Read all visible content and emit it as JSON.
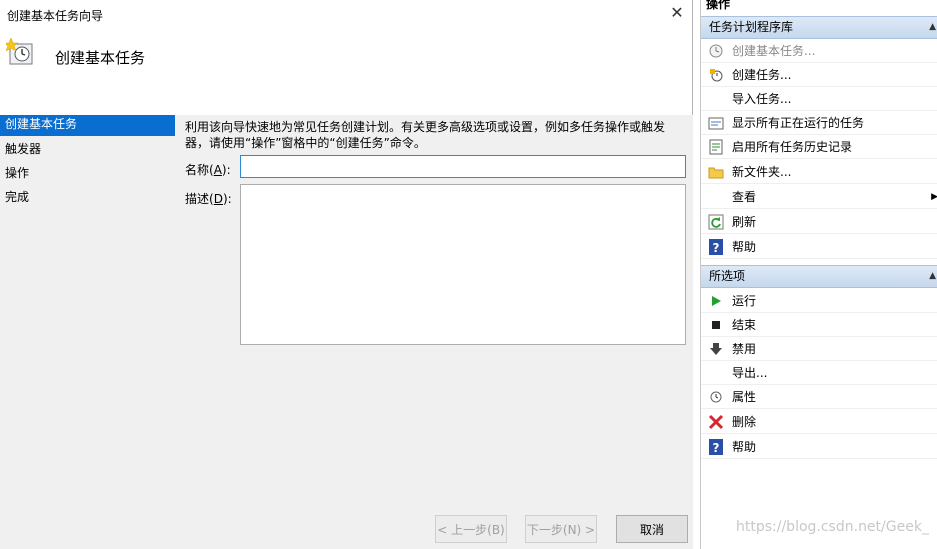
{
  "wizard": {
    "title": "创建基本任务向导",
    "header_title": "创建基本任务",
    "steps": [
      "创建基本任务",
      "触发器",
      "操作",
      "完成"
    ],
    "description": "利用该向导快速地为常见任务创建计划。有关更多高级选项或设置，例如多任务操作或触发器，请使用“操作”窗格中的“创建任务”命令。",
    "name_label": "名称",
    "name_key": "A",
    "name_value": "",
    "desc_label": "描述",
    "desc_key": "D",
    "desc_value": "",
    "prev_label": "< 上一步(B)",
    "next_label": "下一步(N) >",
    "cancel_label": "取消"
  },
  "actions": {
    "title": "操作",
    "section1": {
      "title": "任务计划程序库",
      "items": [
        {
          "label": "创建基本任务...",
          "icon": "clock-wizard-icon"
        },
        {
          "label": "创建任务...",
          "icon": "task-icon"
        },
        {
          "label": "导入任务...",
          "icon": "none"
        },
        {
          "label": "显示所有正在运行的任务",
          "icon": "running-tasks-icon"
        },
        {
          "label": "启用所有任务历史记录",
          "icon": "history-icon"
        },
        {
          "label": "新文件夹...",
          "icon": "folder-icon"
        },
        {
          "label": "查看",
          "icon": "none"
        },
        {
          "label": "刷新",
          "icon": "refresh-icon"
        },
        {
          "label": "帮助",
          "icon": "help-icon"
        }
      ]
    },
    "section2": {
      "title": "所选项",
      "items": [
        {
          "label": "运行",
          "icon": "run-icon"
        },
        {
          "label": "结束",
          "icon": "stop-icon"
        },
        {
          "label": "禁用",
          "icon": "disable-icon"
        },
        {
          "label": "导出...",
          "icon": "none"
        },
        {
          "label": "属性",
          "icon": "properties-icon"
        },
        {
          "label": "删除",
          "icon": "delete-icon"
        },
        {
          "label": "帮助",
          "icon": "help-icon"
        }
      ]
    }
  },
  "watermark": "https://blog.csdn.net/Geek_",
  "colors": {
    "selection": "#0a6ed1",
    "help_blue": "#2a4fa8",
    "run_green": "#1fa12c",
    "delete_red": "#d8262c"
  }
}
